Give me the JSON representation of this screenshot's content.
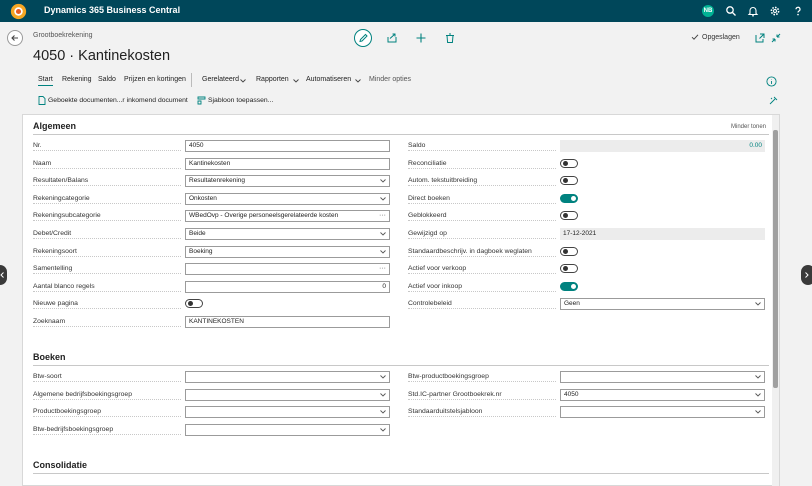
{
  "app": {
    "title": "Dynamics 365 Business Central",
    "avatar": "NB"
  },
  "header": {
    "breadcrumb": "Grootboekrekening",
    "title": "4050 · Kantinekosten",
    "saved_label": "Opgeslagen"
  },
  "tabs": [
    "Start",
    "Rekening",
    "Saldo",
    "Prijzen en kortingen",
    "Gerelateerd",
    "Rapporten",
    "Automatiseren",
    "Minder opties"
  ],
  "actions": {
    "booked_docs": "Geboekte documenten...r inkomend document",
    "apply_template": "Sjabloon toepassen..."
  },
  "general": {
    "title": "Algemeen",
    "show_less": "Minder tonen",
    "left": [
      {
        "label": "Nr.",
        "value": "4050",
        "type": "text"
      },
      {
        "label": "Naam",
        "value": "Kantinekosten",
        "type": "text"
      },
      {
        "label": "Resultaten/Balans",
        "value": "Resultatenrekening",
        "type": "select"
      },
      {
        "label": "Rekeningcategorie",
        "value": "Onkosten",
        "type": "select"
      },
      {
        "label": "Rekeningsubcategorie",
        "value": "WBedOvp - Overige personeelsgerelateerde kosten",
        "type": "lookup"
      },
      {
        "label": "Debet/Credit",
        "value": "Beide",
        "type": "select"
      },
      {
        "label": "Rekeningsoort",
        "value": "Boeking",
        "type": "select"
      },
      {
        "label": "Samentelling",
        "value": "",
        "type": "lookup"
      },
      {
        "label": "Aantal blanco regels",
        "value": "0",
        "type": "number"
      },
      {
        "label": "Nieuwe pagina",
        "value": "",
        "type": "toggle",
        "on": false
      },
      {
        "label": "Zoeknaam",
        "value": "KANTINEKOSTEN",
        "type": "text"
      }
    ],
    "right": [
      {
        "label": "Saldo",
        "value": "0.00",
        "type": "readonly-num"
      },
      {
        "label": "Reconciliatie",
        "value": "",
        "type": "toggle",
        "on": false
      },
      {
        "label": "Autom. tekstuitbreiding",
        "value": "",
        "type": "toggle",
        "on": false
      },
      {
        "label": "Direct boeken",
        "value": "",
        "type": "toggle",
        "on": true
      },
      {
        "label": "Geblokkeerd",
        "value": "",
        "type": "toggle",
        "on": false
      },
      {
        "label": "Gewijzigd op",
        "value": "17-12-2021",
        "type": "readonly"
      },
      {
        "label": "Standaardbeschrijv. in dagboek weglaten",
        "value": "",
        "type": "toggle",
        "on": false
      },
      {
        "label": "Actief voor verkoop",
        "value": "",
        "type": "toggle",
        "on": false
      },
      {
        "label": "Actief voor inkoop",
        "value": "",
        "type": "toggle",
        "on": true
      },
      {
        "label": "Controlebeleid",
        "value": "Geen",
        "type": "select"
      }
    ]
  },
  "posting": {
    "title": "Boeken",
    "left": [
      {
        "label": "Btw-soort",
        "value": "",
        "type": "select"
      },
      {
        "label": "Algemene bedrijfsboekingsgroep",
        "value": "",
        "type": "select"
      },
      {
        "label": "Productboekingsgroep",
        "value": "",
        "type": "select"
      },
      {
        "label": "Btw-bedrijfsboekingsgroep",
        "value": "",
        "type": "select"
      }
    ],
    "right": [
      {
        "label": "Btw-productboekingsgroep",
        "value": "",
        "type": "select"
      },
      {
        "label": "Std.IC-partner Grootboekrek.nr",
        "value": "4050",
        "type": "select"
      },
      {
        "label": "Standaarduitstelsjabloon",
        "value": "",
        "type": "select"
      }
    ]
  },
  "consolidation": {
    "title": "Consolidatie"
  },
  "colors": {
    "topbar": "#00475a",
    "accent": "#00827f"
  }
}
